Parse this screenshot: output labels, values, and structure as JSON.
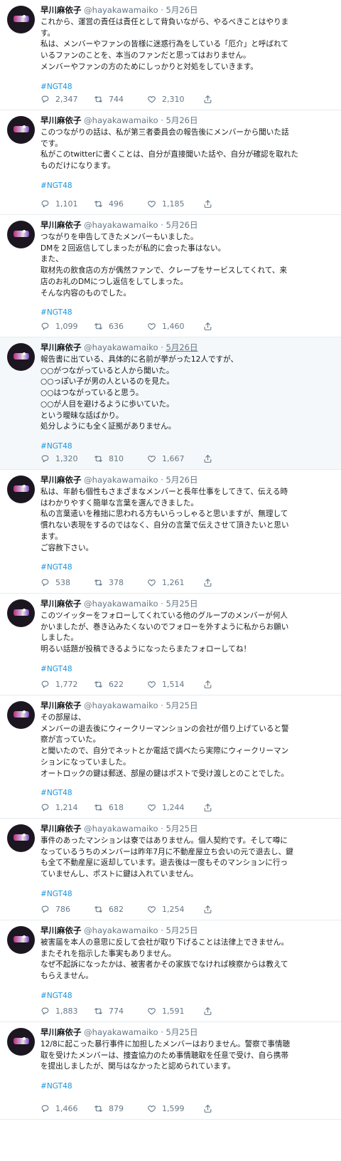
{
  "tweets": [
    {
      "name": "早川麻依子",
      "handle": "@hayakawamaiko",
      "separator": "·",
      "date": "5月26日",
      "lines": [
        "これから、運営の責任は責任として背負いながら、やるべきことはやりま",
        "す。",
        "私は、メンバーやファンの皆様に迷惑行為をしている「厄介」と呼ばれて",
        "いるファンのことを、本当のファンだと思ってはおりません。",
        "メンバーやファンの方のためにしっかりと対処をしていきます。"
      ],
      "hashtag": "#NGT48",
      "replies": "2,347",
      "retweets": "744",
      "likes": "2,310"
    },
    {
      "name": "早川麻依子",
      "handle": "@hayakawamaiko",
      "separator": "·",
      "date": "5月26日",
      "lines": [
        "このつながりの話は、私が第三者委員会の報告後にメンバーから聞いた話",
        "です。",
        "私がこのtwitterに書くことは、自分が直接聞いた話や、自分が確認を取れた",
        "ものだけになります。"
      ],
      "hashtag": "#NGT48",
      "replies": "1,101",
      "retweets": "496",
      "likes": "1,185"
    },
    {
      "name": "早川麻依子",
      "handle": "@hayakawamaiko",
      "separator": "·",
      "date": "5月26日",
      "lines": [
        "つながりを申告してきたメンバーもいました。",
        "DMを２回返信してしまったが私的に会った事はない。",
        "また、",
        "取材先の飲食店の方が偶然ファンで、クレープをサービスしてくれて、来",
        "店のお礼のDMにつし返信をしてしまった。",
        "そんな内容のものでした。"
      ],
      "hashtag": "#NGT48",
      "replies": "1,099",
      "retweets": "636",
      "likes": "1,460"
    },
    {
      "name": "早川麻依子",
      "handle": "@hayakawamaiko",
      "separator": "·",
      "date": "5月26日",
      "lines": [
        "報告書に出ている、具体的に名前が挙がった12人ですが、",
        "○○がつながっていると人から聞いた。",
        "○○っぽい子が男の人といるのを見た。",
        "○○はつながっていると思う。",
        "○○が人目を避けるように歩いていた。",
        "という曖昧な話ばかり。",
        "処分しようにも全く証拠がありません。"
      ],
      "hashtag": "#NGT48",
      "replies": "1,320",
      "retweets": "810",
      "likes": "1,667"
    },
    {
      "name": "早川麻依子",
      "handle": "@hayakawamaiko",
      "separator": "·",
      "date": "5月26日",
      "lines": [
        "私は、年齢も個性もさまざまなメンバーと長年仕事をしてきて、伝える時",
        "はわかりやすく簡単な言葉を選んできました。",
        "私の言葉遣いを稚拙に思われる方もいらっしゃると思いますが、無理して",
        "慣れない表現をするのではなく、自分の言葉で伝えさせて頂きたいと思い",
        "ます。",
        "ご容赦下さい。"
      ],
      "hashtag": "#NGT48",
      "replies": "538",
      "retweets": "378",
      "likes": "1,261"
    },
    {
      "name": "早川麻依子",
      "handle": "@hayakawamaiko",
      "separator": "·",
      "date": "5月25日",
      "lines": [
        "このツイッターをフォローしてくれている他のグループのメンバーが何人",
        "かいましたが、巻き込みたくないのでフォローを外すように私からお願い",
        "しました。",
        "明るい話題が投稿できるようになったらまたフォローしてね！"
      ],
      "hashtag": "#NGT48",
      "replies": "1,772",
      "retweets": "622",
      "likes": "1,514"
    },
    {
      "name": "早川麻依子",
      "handle": "@hayakawamaiko",
      "separator": "·",
      "date": "5月25日",
      "lines": [
        "その部屋は、",
        "メンバーの退去後にウィークリーマンションの会社が借り上げていると警",
        "察が言っていた。",
        "と聞いたので、自分でネットとか電話で調べたら実際にウィークリーマン",
        "ションになっていました。",
        "オートロックの鍵は郵送、部屋の鍵はポストで受け渡しとのことでした。"
      ],
      "hashtag": "#NGT48",
      "replies": "1,214",
      "retweets": "618",
      "likes": "1,244"
    },
    {
      "name": "早川麻依子",
      "handle": "@hayakawamaiko",
      "separator": "·",
      "date": "5月25日",
      "lines": [
        "事件のあったマンションは寮ではありません。個人契約です。そして噂に",
        "なっているうちのメンバーは昨年7月に不動産屋立ち会いの元で退去し、鍵",
        "も全て不動産屋に返却しています。退去後は一度もそのマンションに行っ",
        "ていませんし、ポストに鍵は入れていません。"
      ],
      "hashtag": "#NGT48",
      "replies": "786",
      "retweets": "682",
      "likes": "1,254"
    },
    {
      "name": "早川麻依子",
      "handle": "@hayakawamaiko",
      "separator": "·",
      "date": "5月25日",
      "lines": [
        "被害届を本人の意思に反して会社が取り下げることは法律上できません。",
        "またそれを指示した事実もありません。",
        "なぜ不起訴になったかは、被害者かその家族でなければ検察からは教えて",
        "もらえません。"
      ],
      "hashtag": "#NGT48",
      "replies": "1,883",
      "retweets": "774",
      "likes": "1,591"
    },
    {
      "name": "早川麻依子",
      "handle": "@hayakawamaiko",
      "separator": "·",
      "date": "5月25日",
      "lines": [
        "12/8に起こった暴行事件に加担したメンバーはおりません。警察で事情聴",
        "取を受けたメンバーは、捜査協力のため事情聴取を任意で受け、自ら携帯",
        "を提出しましたが、関与はなかったと認められています。"
      ],
      "hashtag": "#NGT48",
      "replies": "1,466",
      "retweets": "879",
      "likes": "1,599"
    }
  ],
  "colors": {
    "accent": "#1b95e0",
    "muted": "#657786",
    "divider": "#e6ecf0",
    "hover_background": "#f5f8fa"
  },
  "icons": {
    "reply": "reply-icon",
    "retweet": "retweet-icon",
    "like": "like-icon",
    "share": "share-icon"
  }
}
